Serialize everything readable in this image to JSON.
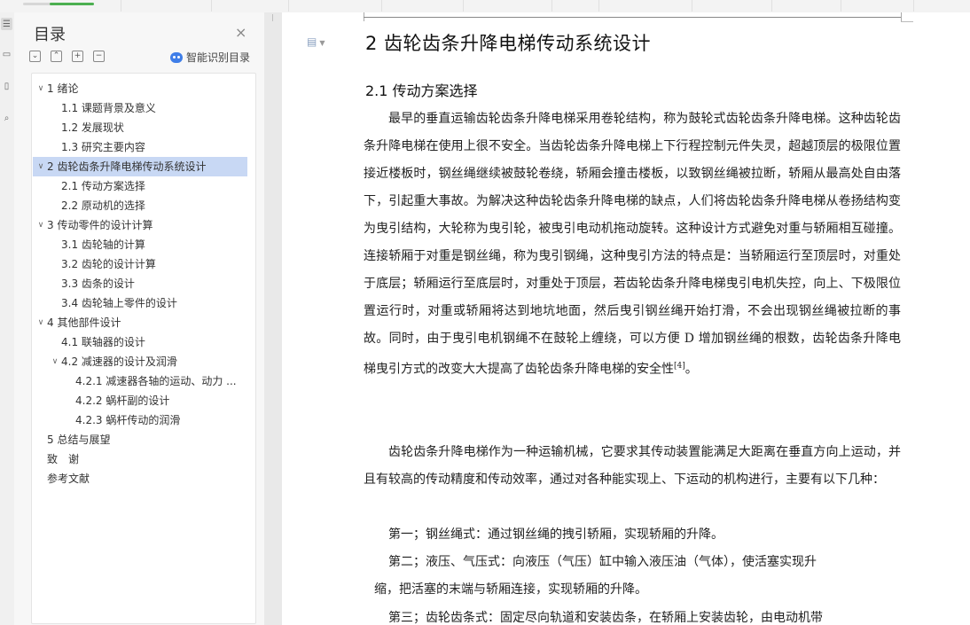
{
  "toc": {
    "title": "目录",
    "close_symbol": "×",
    "tools": [
      "⌄",
      "⌃",
      "+",
      "−"
    ],
    "smart_label": "智能识别目录",
    "items": [
      {
        "level": 1,
        "expanded": true,
        "label": "1 绪论"
      },
      {
        "level": 2,
        "label": "1.1 课题背景及意义"
      },
      {
        "level": 2,
        "label": "1.2 发展现状"
      },
      {
        "level": 2,
        "label": "1.3 研究主要内容"
      },
      {
        "level": 1,
        "expanded": true,
        "selected": true,
        "label": "2 齿轮齿条升降电梯传动系统设计"
      },
      {
        "level": 2,
        "label": "2.1 传动方案选择"
      },
      {
        "level": 2,
        "label": "2.2 原动机的选择"
      },
      {
        "level": 1,
        "expanded": true,
        "label": "3 传动零件的设计计算"
      },
      {
        "level": 2,
        "label": "3.1 齿轮轴的计算"
      },
      {
        "level": 2,
        "label": "3.2 齿轮的设计计算"
      },
      {
        "level": 2,
        "label": "3.3 齿条的设计"
      },
      {
        "level": 2,
        "label": "3.4 齿轮轴上零件的设计"
      },
      {
        "level": 1,
        "expanded": true,
        "label": "4 其他部件设计"
      },
      {
        "level": 2,
        "label": "4.1 联轴器的设计"
      },
      {
        "level": 2,
        "expanded": true,
        "label": "4.2 减速器的设计及润滑"
      },
      {
        "level": 3,
        "label": "4.2.1 减速器各轴的运动、动力 ..."
      },
      {
        "level": 3,
        "label": "4.2.2 蜗杆副的设计"
      },
      {
        "level": 3,
        "label": "4.2.3 蜗杆传动的润滑"
      },
      {
        "level": 1,
        "label": "5 总结与展望"
      },
      {
        "level": 1,
        "label": "致　谢"
      },
      {
        "level": 1,
        "label": "参考文献"
      }
    ]
  },
  "document": {
    "heading1": "2 齿轮齿条升降电梯传动系统设计",
    "heading2": "2.1 传动方案选择",
    "paragraph1": "最早的垂直运输齿轮齿条升降电梯采用卷轮结构，称为鼓轮式齿轮齿条升降电梯。这种齿轮齿条升降电梯在使用上很不安全。当齿轮齿条升降电梯上下行程控制元件失灵，超越顶层的极限位置接近楼板时，钢丝绳继续被鼓轮卷绕，轿厢会撞击楼板，以致钢丝绳被拉断，轿厢从最高处自由落下，引起重大事故。为解决这种齿轮齿条升降电梯的缺点，人们将齿轮齿条升降电梯从卷扬结构变为曳引结构，大轮称为曳引轮，被曳引电动机拖动旋转。这种设计方式避免对重与轿厢相互碰撞。连接轿厢于对重是钢丝绳，称为曳引钢绳，这种曳引方法的特点是：当轿厢运行至顶层时，对重处于底层；轿厢运行至底层时，对重处于顶层，若齿轮齿条升降电梯曳引电机失控，向上、下极限位置运行时，对重或轿厢将达到地坑地面，然后曳引钢丝绳开始打滑，不会出现钢丝绳被拉断的事故。同时，由于曳引电机钢绳不在鼓轮上缠绕，可以方便 D 增加钢丝绳的根数，齿轮齿条升降电梯曳引方式的改变大大提高了齿轮齿条升降电梯的安全性",
    "citation": "[4]",
    "paragraph1_end": "。",
    "paragraph2": "齿轮齿条升降电梯作为一种运输机械，它要求其传动装置能满足大距离在垂直方向上运动，并且有较高的传动精度和传动效率，通过对各种能实现上、下运动的机构进行，主要有以下几种：",
    "item1": "第一；钢丝绳式：通过钢丝绳的拽引轿厢，实现轿厢的升降。",
    "item2a": "第二；液压、气压式：向液压（气压）缸中输入液压油（气体），使活塞实现升",
    "item2b": "缩，把活塞的末端与轿厢连接，实现轿厢的升降。",
    "item3": "第三；齿轮齿条式：固定尽向轨道和安装齿条，在轿厢上安装齿轮，由电动机带"
  }
}
